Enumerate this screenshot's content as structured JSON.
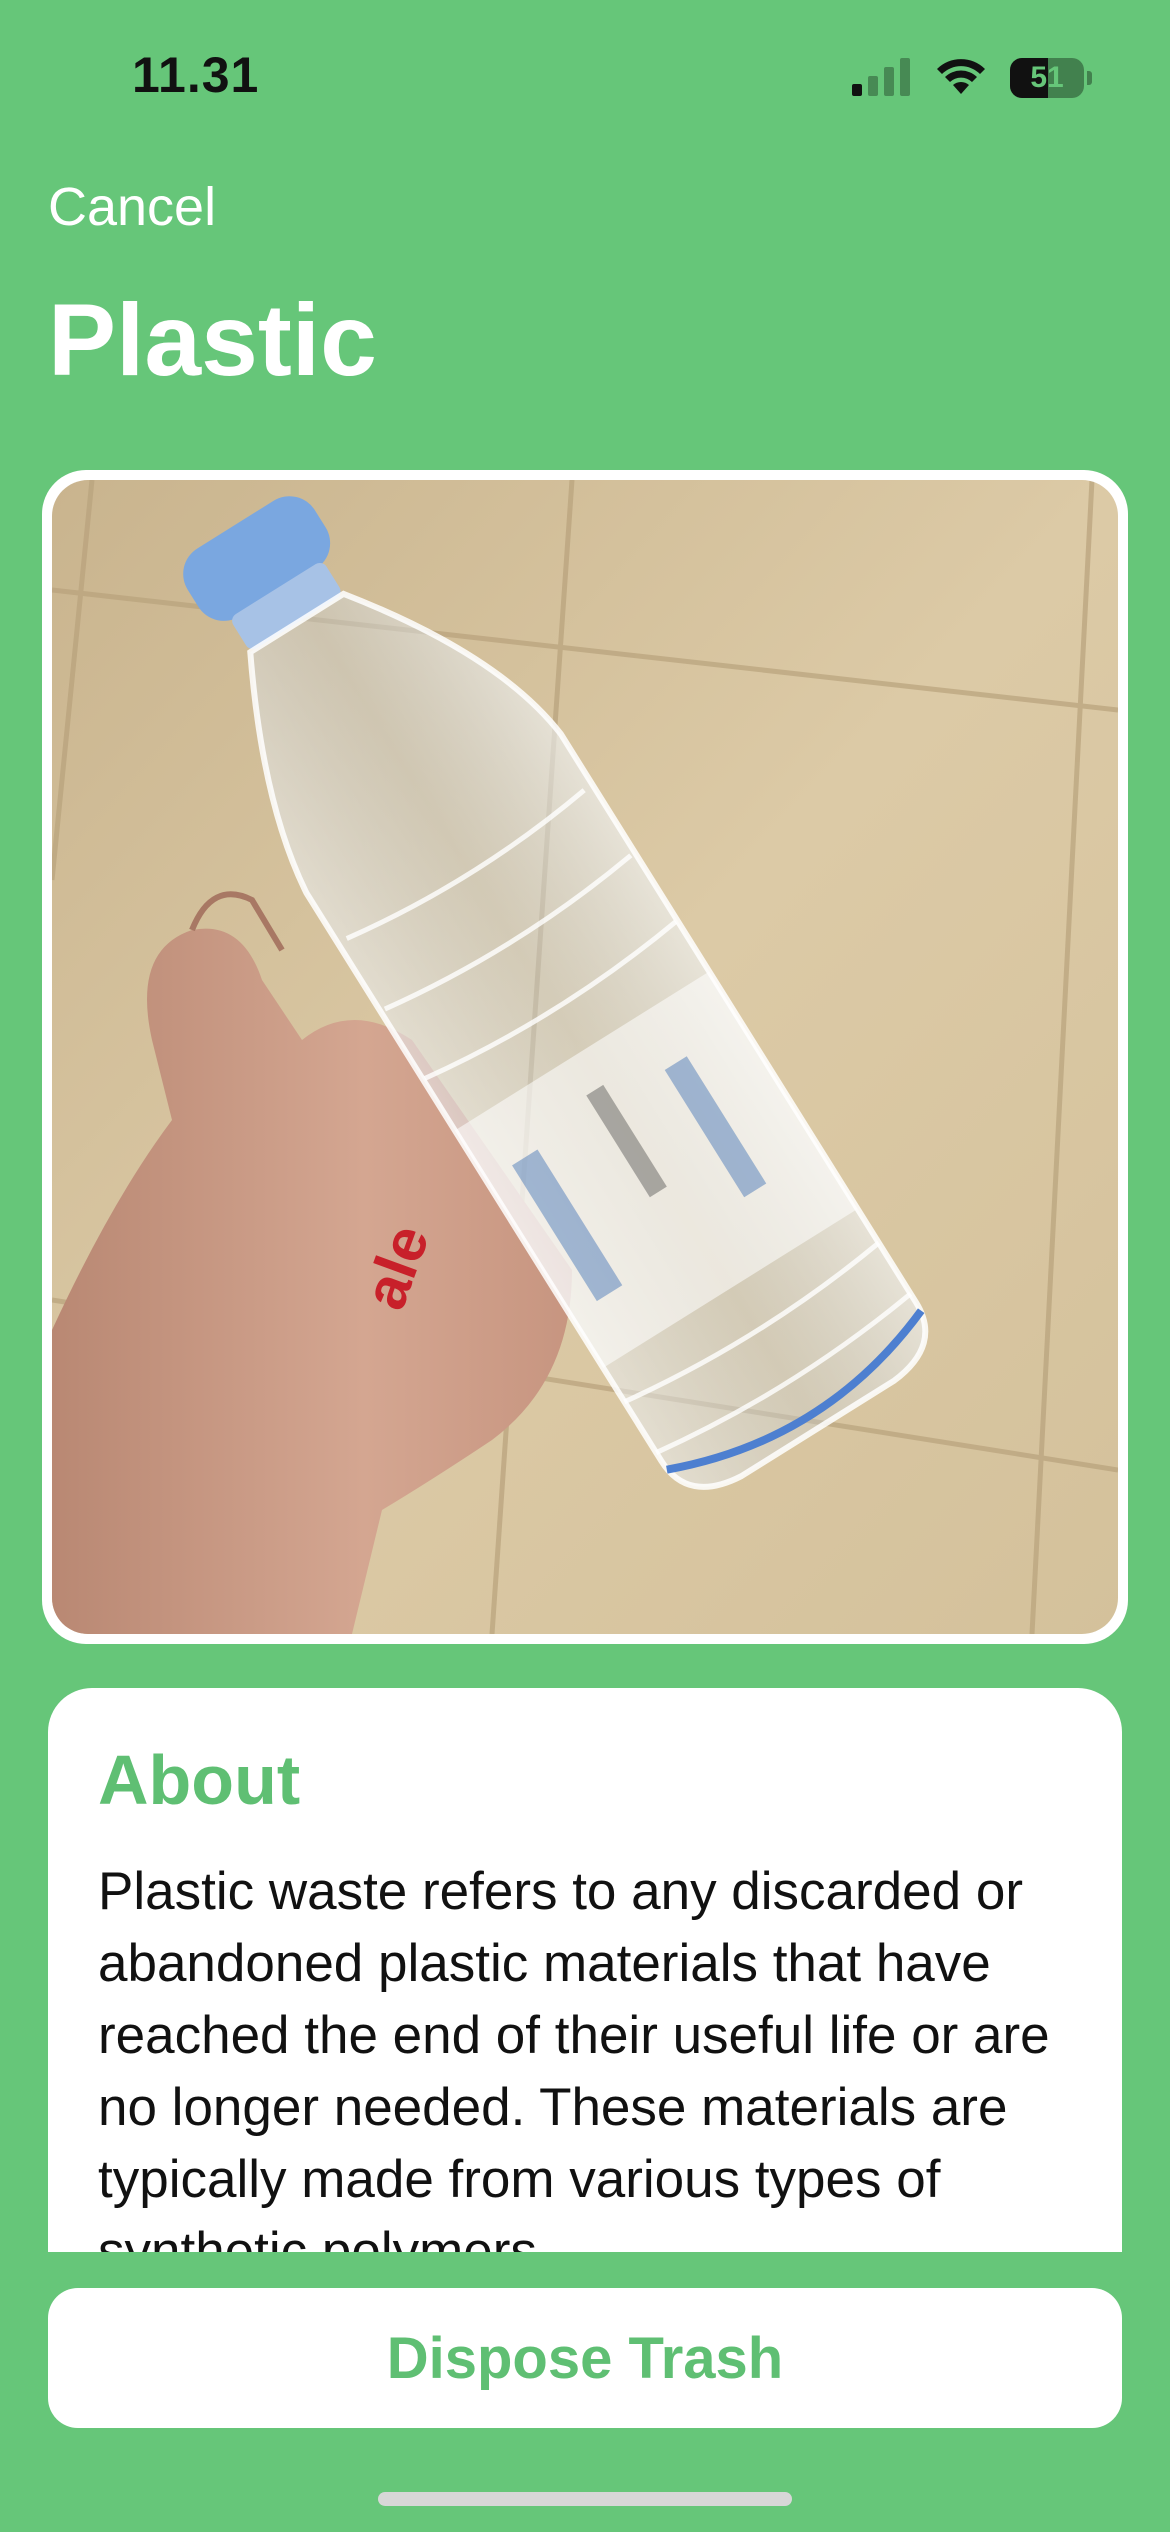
{
  "status_bar": {
    "time": "11.31",
    "battery_level": "51",
    "signal_bars_active": 1,
    "signal_bars_total": 4
  },
  "nav": {
    "cancel_label": "Cancel",
    "title": "Plastic"
  },
  "photo": {
    "subject": "hand holding a clear plastic water bottle with a blue cap on a tiled floor",
    "label_text": "ale"
  },
  "about": {
    "heading": "About",
    "body": "Plastic waste refers to any discarded or abandoned plastic materials that have reached the end of their useful life or are no longer needed. These materials are typically made from various types of synthetic polymers"
  },
  "actions": {
    "dispose_label": "Dispose Trash"
  },
  "colors": {
    "background": "#66c679",
    "accent_text": "#5fbf73",
    "card": "#ffffff"
  }
}
